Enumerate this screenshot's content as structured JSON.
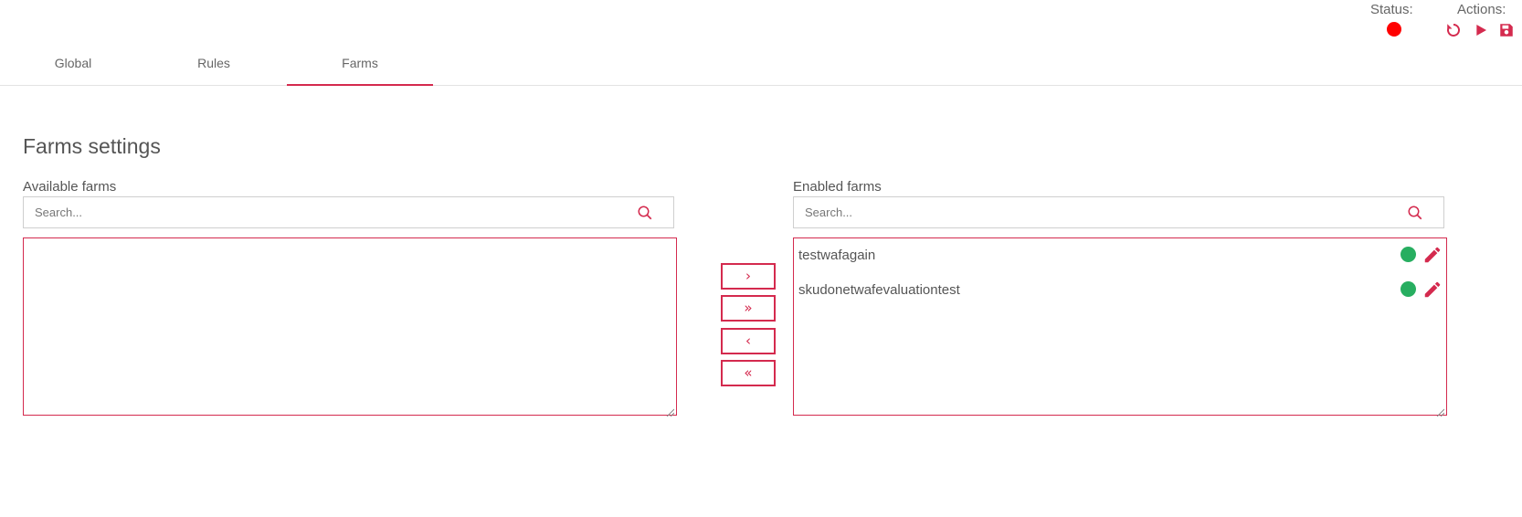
{
  "header": {
    "status_label": "Status:",
    "actions_label": "Actions:",
    "status_color": "#ff0000",
    "action_icons": [
      "restart-icon",
      "play-icon",
      "save-icon"
    ]
  },
  "tabs": [
    {
      "label": "Global",
      "active": false
    },
    {
      "label": "Rules",
      "active": false
    },
    {
      "label": "Farms",
      "active": true
    }
  ],
  "page_title": "Farms settings",
  "available": {
    "label": "Available farms",
    "search_placeholder": "Search...",
    "items": []
  },
  "enabled": {
    "label": "Enabled farms",
    "search_placeholder": "Search...",
    "items": [
      {
        "name": "testwafagain",
        "status_color": "#27ae60"
      },
      {
        "name": "skudonetwafevaluationtest",
        "status_color": "#27ae60"
      }
    ]
  },
  "move_buttons": {
    "move_selected_right": "›",
    "move_all_right": "»",
    "move_selected_left": "‹",
    "move_all_left": "«"
  },
  "colors": {
    "accent": "#d42a4e",
    "enabled_status": "#27ae60"
  }
}
